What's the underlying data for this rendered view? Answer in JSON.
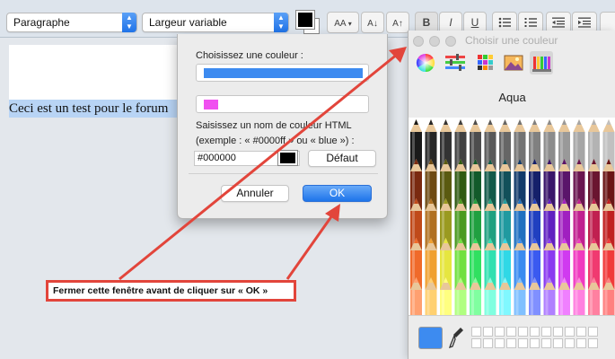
{
  "toolbar": {
    "paragraph_select": "Paragraphe",
    "font_select": "Largeur variable",
    "font_size_label": "AA",
    "bold_label": "B",
    "italic_label": "I",
    "underline_label": "U"
  },
  "document": {
    "text": "Ceci est un test pour le forum"
  },
  "dialog": {
    "choose_color_label": "Choisissez une couleur :",
    "text_color": "#3d8bf0",
    "bg_color": "#f050f0",
    "html_label_line1": "Saisissez un nom de couleur HTML",
    "html_label_line2": "(exemple : « #0000ff » ou « blue ») :",
    "hex_value": "#000000",
    "default_button": "Défaut",
    "cancel_button": "Annuler",
    "ok_button": "OK"
  },
  "picker": {
    "title": "Choisir une couleur",
    "selected_name": "Aqua",
    "selected_color": "#3d8bf0",
    "tabs": [
      "color-wheel-icon",
      "sliders-icon",
      "palettes-icon",
      "image-palette-icon",
      "pencils-icon"
    ]
  },
  "annotation": {
    "text": "Fermer cette fenêtre avant de cliquer sur « OK »",
    "color": "#e2453b"
  }
}
